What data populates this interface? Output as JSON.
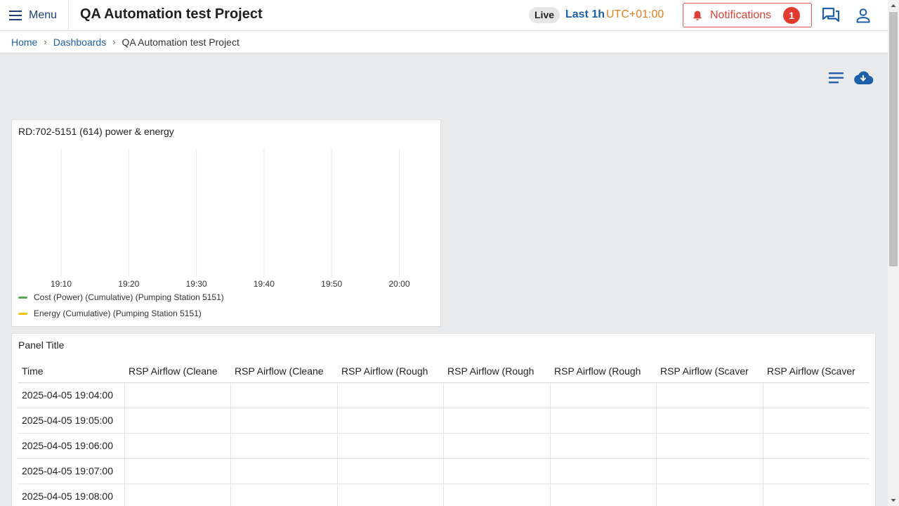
{
  "header": {
    "menu_label": "Menu",
    "project_title": "QA Automation test Project",
    "live_label": "Live",
    "time_range": "Last 1h",
    "timezone": "UTC+01:00",
    "notifications_label": "Notifications",
    "notifications_count": "1"
  },
  "breadcrumb": {
    "home": "Home",
    "dashboards": "Dashboards",
    "current": "QA Automation test Project",
    "separator": "›"
  },
  "chart_panel": {
    "title": "RD:702-5151 (614) power & energy",
    "chart_data": {
      "type": "line",
      "x_ticks": [
        "19:10",
        "19:20",
        "19:30",
        "19:40",
        "19:50",
        "20:00"
      ],
      "series": [
        {
          "name": "Cost (Power) (Cumulative) (Pumping Station 5151)",
          "color": "#4caf50",
          "values": []
        },
        {
          "name": "Energy (Cumulative) (Pumping Station 5151)",
          "color": "#f2c200",
          "values": []
        }
      ],
      "grid": "vertical"
    }
  },
  "table_panel": {
    "title": "Panel Title",
    "columns": [
      "Time",
      "RSP Airflow (Cleane",
      "RSP Airflow (Cleane",
      "RSP Airflow (Rough",
      "RSP Airflow (Rough",
      "RSP Airflow (Rough",
      "RSP Airflow (Scaver",
      "RSP Airflow (Scaver"
    ],
    "rows": [
      [
        "2025-04-05 19:04:00",
        "",
        "",
        "",
        "",
        "",
        "",
        ""
      ],
      [
        "2025-04-05 19:05:00",
        "",
        "",
        "",
        "",
        "",
        "",
        ""
      ],
      [
        "2025-04-05 19:06:00",
        "",
        "",
        "",
        "",
        "",
        "",
        ""
      ],
      [
        "2025-04-05 19:07:00",
        "",
        "",
        "",
        "",
        "",
        "",
        ""
      ],
      [
        "2025-04-05 19:08:00",
        "",
        "",
        "",
        "",
        "",
        "",
        ""
      ]
    ]
  },
  "colors": {
    "brand_blue": "#1d5fa8",
    "timezone_orange": "#e07d1f",
    "alert_red": "#e33b2f"
  }
}
